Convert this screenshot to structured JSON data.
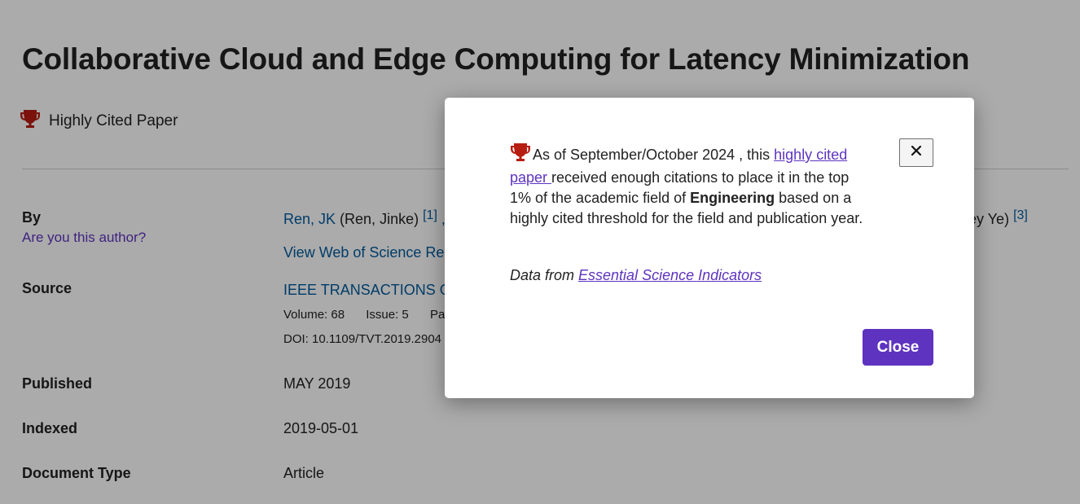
{
  "record": {
    "title": "Collaborative Cloud and Edge Computing for Latency Minimization",
    "highly_cited_label": "Highly Cited Paper",
    "by_label": "By",
    "are_you_author": "Are you this author?",
    "author_link": "Ren, JK",
    "author_full": "(Ren, Jinke)",
    "author_ref": "[1]",
    "author_sep": ",",
    "author_tail": "rey Ye)",
    "author_tail_ref": "[3]",
    "view_researcher": "View Web of Science Res",
    "source_label": "Source",
    "source_value": "IEEE TRANSACTIONS ON",
    "volume": "Volume: 68",
    "issue": "Issue: 5",
    "pages_partial": "Pa",
    "doi": "DOI: 10.1109/TVT.2019.2904",
    "published_label": "Published",
    "published_value": "MAY 2019",
    "indexed_label": "Indexed",
    "indexed_value": "2019-05-01",
    "doctype_label": "Document Type",
    "doctype_value": "Article"
  },
  "modal": {
    "text_a": "As of September/October 2024 , this ",
    "link_text": "highly cited paper ",
    "text_b": "received enough citations to place it in the top 1% of the academic field of ",
    "field": "Engineering",
    "text_c": " based on a highly cited threshold for the field and publication year.",
    "source_prefix": "Data from ",
    "source_link": "Essential Science Indicators",
    "close_label": "Close",
    "x_label": "×"
  },
  "colors": {
    "trophy": "#b81d12",
    "accent": "#5e33bf",
    "link": "#005a9c"
  }
}
